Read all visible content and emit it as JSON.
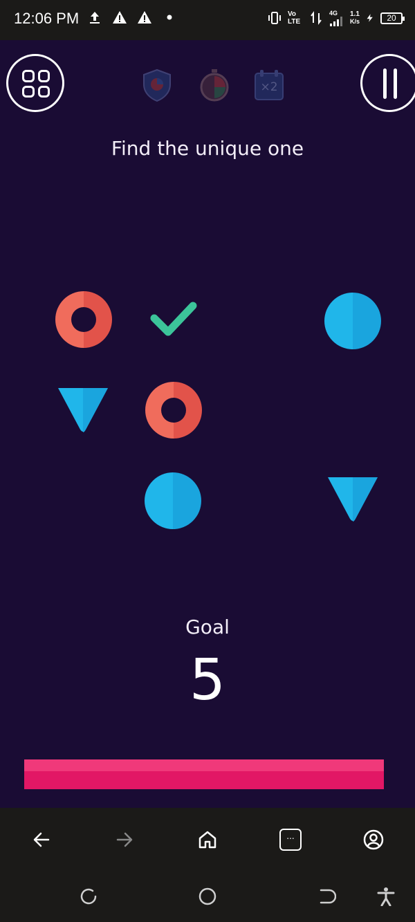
{
  "status_bar": {
    "time": "12:06 PM",
    "network_speed_value": "1.1",
    "network_speed_unit": "K/s",
    "network_type": "4G",
    "volte_label": "Vo LTE",
    "battery_level": "20",
    "icons": [
      "upload-icon",
      "warning-icon",
      "warning-icon",
      "dot-icon",
      "vibrate-icon",
      "volte-icon",
      "data-transfer-icon",
      "signal-icon",
      "charging-icon",
      "battery-icon"
    ]
  },
  "game": {
    "instruction": "Find the unique one",
    "goal_label": "Goal",
    "goal_value": "5",
    "progress_fraction": 1.0,
    "powerups": [
      "shield-powerup-icon",
      "timer-powerup-icon",
      "x2-powerup-icon"
    ],
    "powerup_x2_label": "×2",
    "colors": {
      "background": "#1a0c34",
      "red_shape": "#e2534a",
      "blue_shape": "#20b6ea",
      "check": "#3cc49a",
      "progress": "#e21765"
    },
    "tiles": [
      {
        "shape": "ring",
        "color": "red"
      },
      {
        "shape": "checkmark",
        "color": "green"
      },
      {
        "shape": "disc",
        "color": "blue"
      },
      {
        "shape": "triangle-down",
        "color": "blue"
      },
      {
        "shape": "ring",
        "color": "red"
      },
      {
        "shape": "disc",
        "color": "blue"
      },
      {
        "shape": "triangle-down",
        "color": "blue"
      }
    ]
  },
  "browser_nav": {
    "icons": [
      "back-arrow-icon",
      "forward-arrow-icon",
      "home-icon",
      "tabs-icon",
      "account-icon"
    ],
    "tabs_label": "..."
  },
  "system_nav": {
    "icons": [
      "recents-icon",
      "home-circle-icon",
      "back-icon",
      "accessibility-icon"
    ]
  }
}
